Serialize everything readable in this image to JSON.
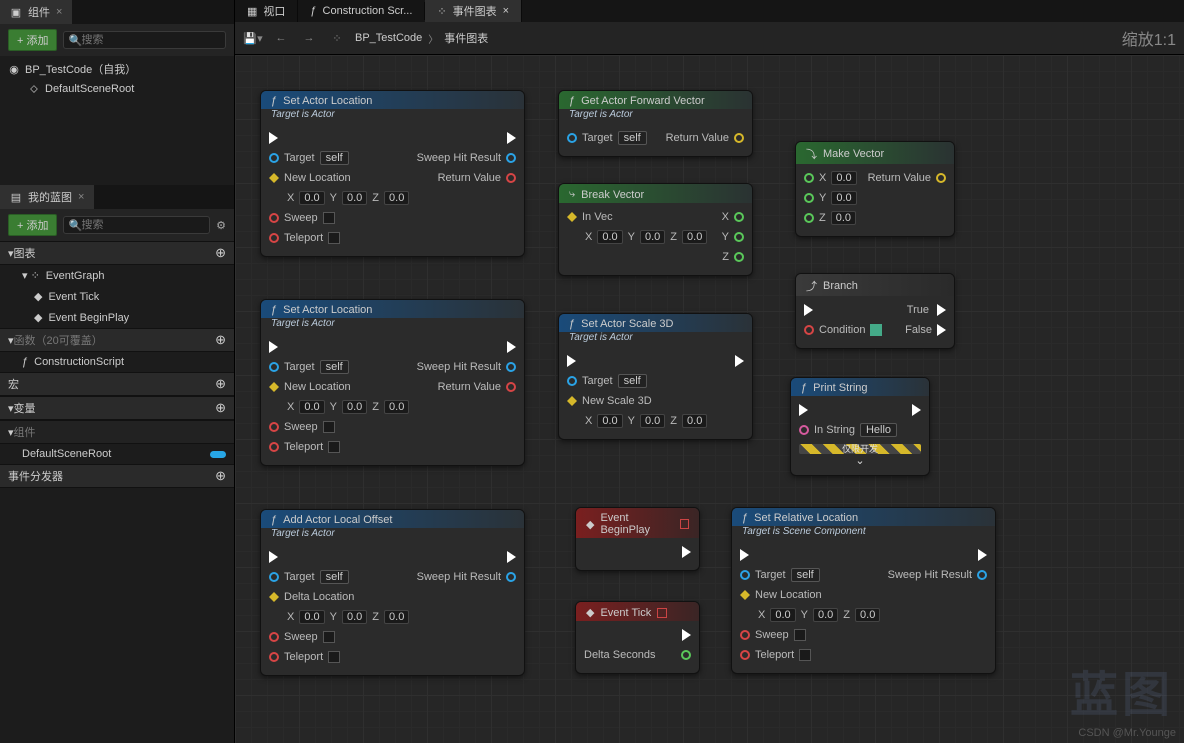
{
  "leftPanel1": {
    "tabTitle": "组件",
    "addLabel": "+ 添加",
    "searchPlaceholder": "搜索",
    "root": "BP_TestCode（自我）",
    "child": "DefaultSceneRoot"
  },
  "leftPanel2": {
    "tabTitle": "我的蓝图",
    "addLabel": "+ 添加",
    "searchPlaceholder": "搜索",
    "sections": {
      "graphs": "图表",
      "eventGraph": "EventGraph",
      "eventTick": "Event Tick",
      "eventBeginPlay": "Event BeginPlay",
      "funcs": "函数（20可覆盖）",
      "construction": "ConstructionScript",
      "macros": "宏",
      "vars": "变量",
      "components": "组件",
      "defaultSceneRoot": "DefaultSceneRoot",
      "dispatchers": "事件分发器"
    }
  },
  "topTabs": {
    "viewport": "视口",
    "construction": "Construction Scr...",
    "eventGraph": "事件图表"
  },
  "breadcrumb": {
    "a": "BP_TestCode",
    "b": "事件图表"
  },
  "zoom": "缩放1:1",
  "labels": {
    "targetIsActor": "Target is Actor",
    "targetIsScene": "Target is Scene Component",
    "target": "Target",
    "self": "self",
    "newLocation": "New Location",
    "newScale": "New Scale 3D",
    "deltaLocation": "Delta Location",
    "inVec": "In Vec",
    "inString": "In String",
    "hello": "Hello",
    "sweep": "Sweep",
    "teleport": "Teleport",
    "sweepHit": "Sweep Hit Result",
    "returnValue": "Return Value",
    "condition": "Condition",
    "true": "True",
    "false": "False",
    "x": "X",
    "y": "Y",
    "z": "Z",
    "devOnly": "仅限开发",
    "deltaSeconds": "Delta Seconds"
  },
  "nodes": {
    "setLoc1": "Set Actor Location",
    "setLoc2": "Set Actor Location",
    "addOffset": "Add Actor Local Offset",
    "getForward": "Get Actor Forward Vector",
    "breakVec": "Break Vector",
    "setScale": "Set Actor Scale 3D",
    "makeVec": "Make Vector",
    "branch": "Branch",
    "printStr": "Print String",
    "beginPlay": "Event BeginPlay",
    "tick": "Event Tick",
    "setRel": "Set Relative Location"
  },
  "num": "0.0",
  "watermark": "蓝图",
  "credit": "CSDN @Mr.Younge"
}
